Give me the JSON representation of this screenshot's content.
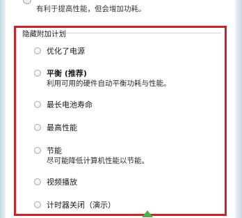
{
  "top_option": {
    "description": "有利于提高性能，但会增加功耗。"
  },
  "group": {
    "title": "隐藏附加计划"
  },
  "options": [
    {
      "label": "优化了电源",
      "description": "",
      "bold": false
    },
    {
      "label": "平衡 (推荐)",
      "description": "利用可用的硬件自动平衡功耗与性能。",
      "bold": true
    },
    {
      "label": "最长电池寿命",
      "description": "",
      "bold": false
    },
    {
      "label": "最高性能",
      "description": "",
      "bold": false
    },
    {
      "label": "节能",
      "description": "尽可能降低计算机性能以节能。",
      "bold": false
    },
    {
      "label": "视频播放",
      "description": "",
      "bold": false
    },
    {
      "label": "计时器关闭（演示）",
      "description": "",
      "bold": false
    }
  ],
  "colors": {
    "highlight_border": "#c8242b",
    "window_frame": "#c9d7e6"
  }
}
